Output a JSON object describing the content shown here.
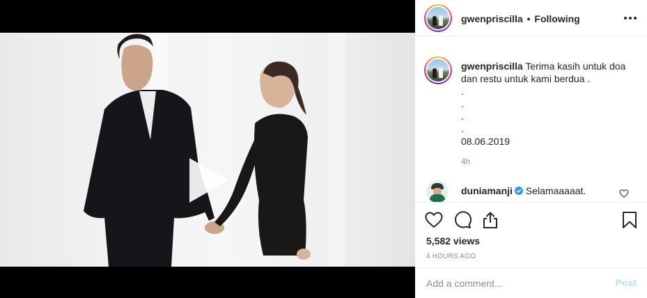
{
  "post": {
    "author": "gwenpriscilla",
    "follow_separator": "•",
    "follow_status": "Following"
  },
  "caption": {
    "author": "gwenpriscilla",
    "line1": "Terima kasih untuk doa",
    "line2": "dan restu untuk kami berdua .",
    "dot1": ".",
    "dot2": ".",
    "dot3": ".",
    "dot4": ".",
    "date": "08.06.2019",
    "time": "4h"
  },
  "comment": {
    "author": "duniamanji",
    "verified": true,
    "text": "Selamaaaaat."
  },
  "stats": {
    "views": "5,582 views",
    "age": "4 HOURS AGO"
  },
  "comment_form": {
    "placeholder": "Add a comment...",
    "post_label": "Post"
  },
  "icons": {
    "play": "play-icon",
    "more": "more-options-icon",
    "like": "heart-icon",
    "comment": "comment-bubble-icon",
    "share": "share-icon",
    "save": "bookmark-icon",
    "verified": "verified-badge-icon"
  },
  "colors": {
    "text": "#262626",
    "muted": "#8e8e8e",
    "verified": "#3897f0",
    "post_disabled": "#b2dffc",
    "divider": "#efefef"
  }
}
